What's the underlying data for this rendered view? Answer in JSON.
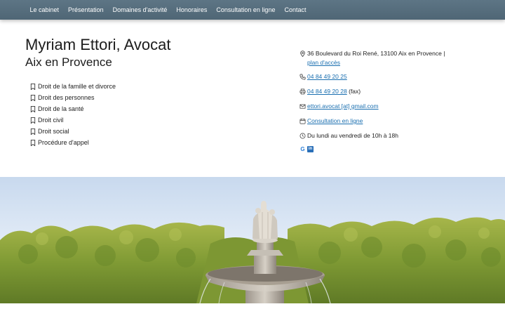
{
  "nav": {
    "items": [
      {
        "label": "Le cabinet"
      },
      {
        "label": "Présentation"
      },
      {
        "label": "Domaines d'activité"
      },
      {
        "label": "Honoraires"
      },
      {
        "label": "Consultation en ligne"
      },
      {
        "label": "Contact"
      }
    ]
  },
  "header": {
    "title": "Myriam Ettori, Avocat",
    "subtitle": "Aix en Provence"
  },
  "practice_areas": [
    {
      "label": "Droit de la famille et divorce"
    },
    {
      "label": "Droit des personnes"
    },
    {
      "label": "Droit de la santé"
    },
    {
      "label": "Droit civil"
    },
    {
      "label": "Droit social"
    },
    {
      "label": "Procédure d'appel"
    }
  ],
  "contact": {
    "address": "36 Boulevard du Roi René, 13100 Aix en Provence |",
    "map_link": "plan d'accès",
    "phone": "04 84 49 20 25",
    "fax": "04 84 49 20 28",
    "fax_suffix": "(fax)",
    "email": "ettori.avocat [at] gmail.com",
    "consultation_link": "Consultation en ligne",
    "hours": "Du lundi au vendredi de 10h à 18h"
  },
  "social": {
    "google_letter": "G",
    "linkedin_letters": "in"
  },
  "colors": {
    "navbar": "#566e7e",
    "link": "#1a6fb0",
    "foliage": "#8aa23a",
    "sky": "#dfeaf6"
  },
  "hero": {
    "subject": "fountain-with-statues-and-trees"
  }
}
